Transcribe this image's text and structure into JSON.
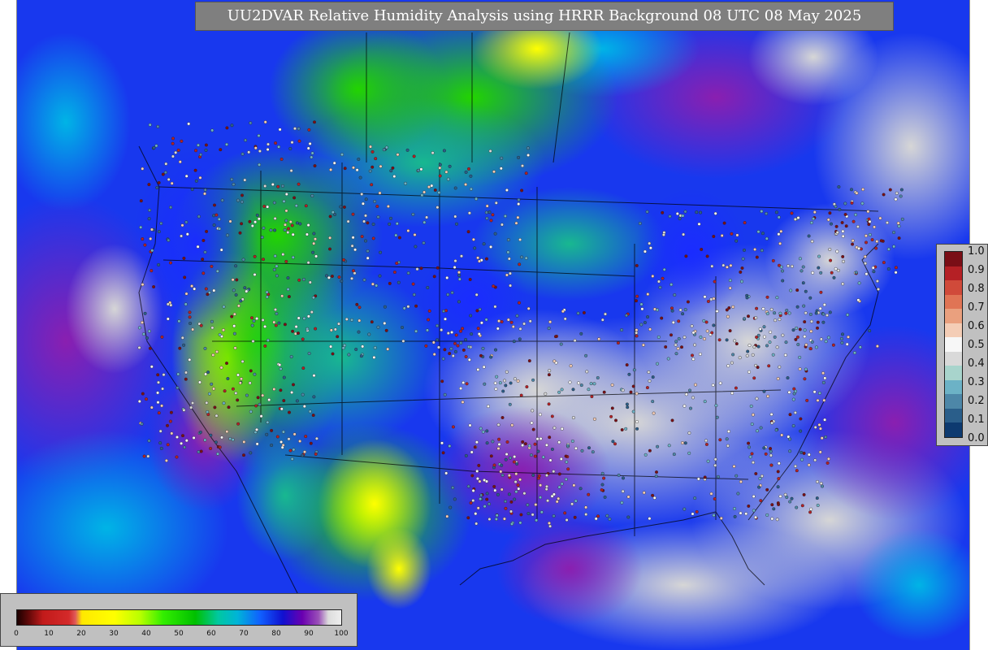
{
  "title": "UU2DVAR Relative Humidity Analysis using HRRR Background 08 UTC 08 May 2025",
  "map": {
    "region": "Contiguous United States",
    "background_field": "relative humidity (%)",
    "observations_overlay": "relative humidity error/ratio (0.0-1.0) station dots"
  },
  "colorbar_vertical": {
    "ticks": [
      "1.0",
      "0.9",
      "0.8",
      "0.7",
      "0.6",
      "0.5",
      "0.4",
      "0.3",
      "0.2",
      "0.1",
      "0.0"
    ],
    "colors": [
      "#7a0e16",
      "#b52025",
      "#d04a3a",
      "#e07455",
      "#eaa07e",
      "#f4cdb6",
      "#f7f7f7",
      "#d9d9d9",
      "#a8d4cc",
      "#6cb2c6",
      "#4d87a8",
      "#2a5e8a",
      "#0d3a70"
    ]
  },
  "colorbar_horizontal": {
    "ticks": [
      "0",
      "10",
      "20",
      "30",
      "40",
      "50",
      "60",
      "70",
      "80",
      "90",
      "100"
    ],
    "stops": [
      {
        "v": 0,
        "c": "#1a0000"
      },
      {
        "v": 4,
        "c": "#6a0a0a"
      },
      {
        "v": 8,
        "c": "#c21a1a"
      },
      {
        "v": 16,
        "c": "#d42a2a"
      },
      {
        "v": 18,
        "c": "#e05a5a"
      },
      {
        "v": 20,
        "c": "#ffe800"
      },
      {
        "v": 30,
        "c": "#ffff00"
      },
      {
        "v": 38,
        "c": "#b8ff00"
      },
      {
        "v": 45,
        "c": "#33ee00"
      },
      {
        "v": 55,
        "c": "#00c000"
      },
      {
        "v": 62,
        "c": "#00c8a0"
      },
      {
        "v": 68,
        "c": "#00b4d8"
      },
      {
        "v": 75,
        "c": "#1060ff"
      },
      {
        "v": 82,
        "c": "#1010d0"
      },
      {
        "v": 88,
        "c": "#6a00b0"
      },
      {
        "v": 93,
        "c": "#9a50b8"
      },
      {
        "v": 96,
        "c": "#dcdcdc"
      },
      {
        "v": 100,
        "c": "#eeeeee"
      }
    ]
  }
}
